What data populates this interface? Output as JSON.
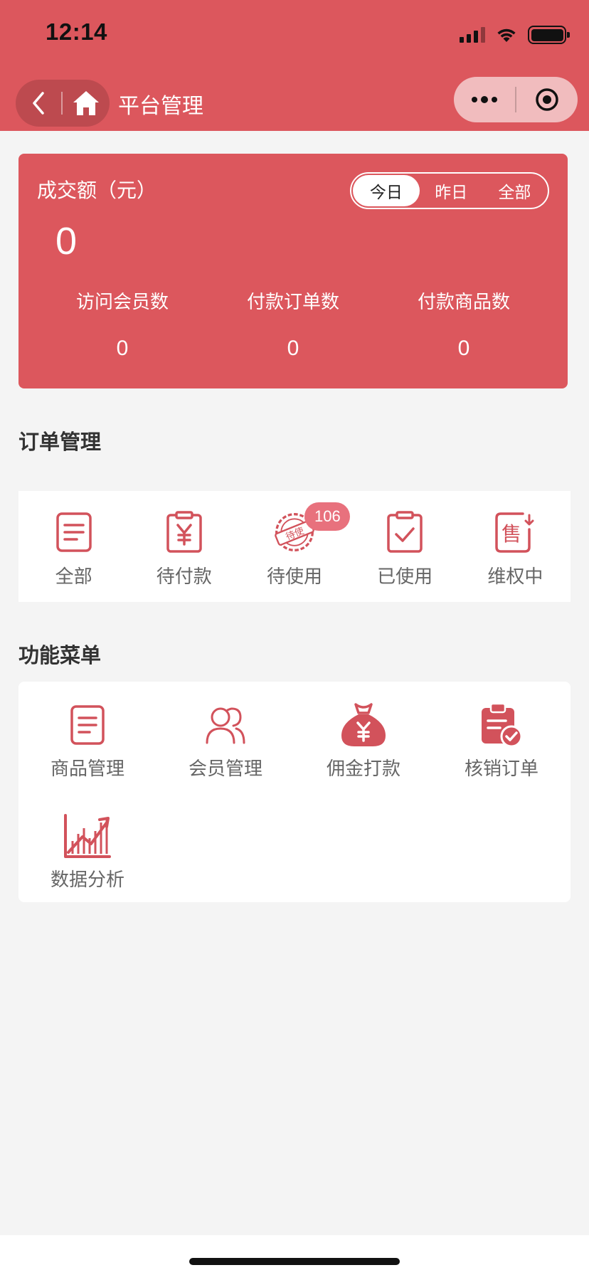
{
  "status_bar": {
    "time": "12:14"
  },
  "nav": {
    "title": "平台管理"
  },
  "stats": {
    "title": "成交额（元）",
    "amount": "0",
    "periods": [
      {
        "label": "今日",
        "active": true
      },
      {
        "label": "昨日",
        "active": false
      },
      {
        "label": "全部",
        "active": false
      }
    ],
    "metrics": [
      {
        "label": "访问会员数",
        "value": "0"
      },
      {
        "label": "付款订单数",
        "value": "0"
      },
      {
        "label": "付款商品数",
        "value": "0"
      }
    ]
  },
  "orders": {
    "title": "订单管理",
    "items": [
      {
        "label": "全部",
        "icon": "document-icon"
      },
      {
        "label": "待付款",
        "icon": "pending-payment-icon"
      },
      {
        "label": "待使用",
        "icon": "pending-use-stamp-icon",
        "badge": "106",
        "stamp_text": "待使"
      },
      {
        "label": "已使用",
        "icon": "used-check-icon"
      },
      {
        "label": "维权中",
        "icon": "after-sale-icon",
        "glyph": "售"
      }
    ]
  },
  "menu": {
    "title": "功能菜单",
    "items": [
      {
        "label": "商品管理",
        "icon": "goods-icon"
      },
      {
        "label": "会员管理",
        "icon": "members-icon"
      },
      {
        "label": "佣金打款",
        "icon": "money-bag-icon"
      },
      {
        "label": "核销订单",
        "icon": "verify-order-icon"
      },
      {
        "label": "数据分析",
        "icon": "data-chart-icon"
      }
    ]
  },
  "colors": {
    "brand": "#dc575d",
    "icon": "#d2525b",
    "badge": "#e8717d",
    "background": "#f4f4f4"
  }
}
